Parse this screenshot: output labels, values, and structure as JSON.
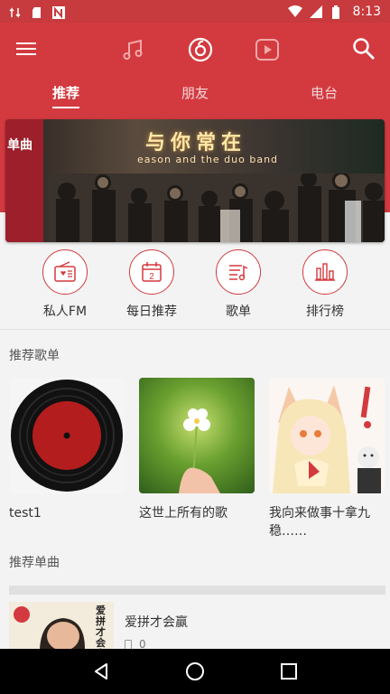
{
  "status": {
    "time": "8:13"
  },
  "tabs": [
    {
      "label": "推荐"
    },
    {
      "label": "朋友"
    },
    {
      "label": "电台"
    }
  ],
  "banner": {
    "tag": "单曲",
    "title": "与你常在",
    "subtitle": "eason and the duo band"
  },
  "quick_actions": [
    {
      "label": "私人FM",
      "icon": "radio-icon"
    },
    {
      "label": "每日推荐",
      "icon": "calendar-icon",
      "day": "2"
    },
    {
      "label": "歌单",
      "icon": "playlist-icon"
    },
    {
      "label": "排行榜",
      "icon": "chart-icon"
    }
  ],
  "sections": {
    "recommended_playlists": "推荐歌单",
    "recommended_songs": "推荐单曲"
  },
  "playlists": [
    {
      "title": "test1"
    },
    {
      "title": "这世上所有的歌"
    },
    {
      "title": "我向来做事十拿九稳……"
    }
  ],
  "single": {
    "cover_text": "爱拼才会赢",
    "title": "爱拼才会赢",
    "count": "0"
  },
  "colors": {
    "accent": "#d33a3f",
    "status_bar": "#c73a3d"
  }
}
